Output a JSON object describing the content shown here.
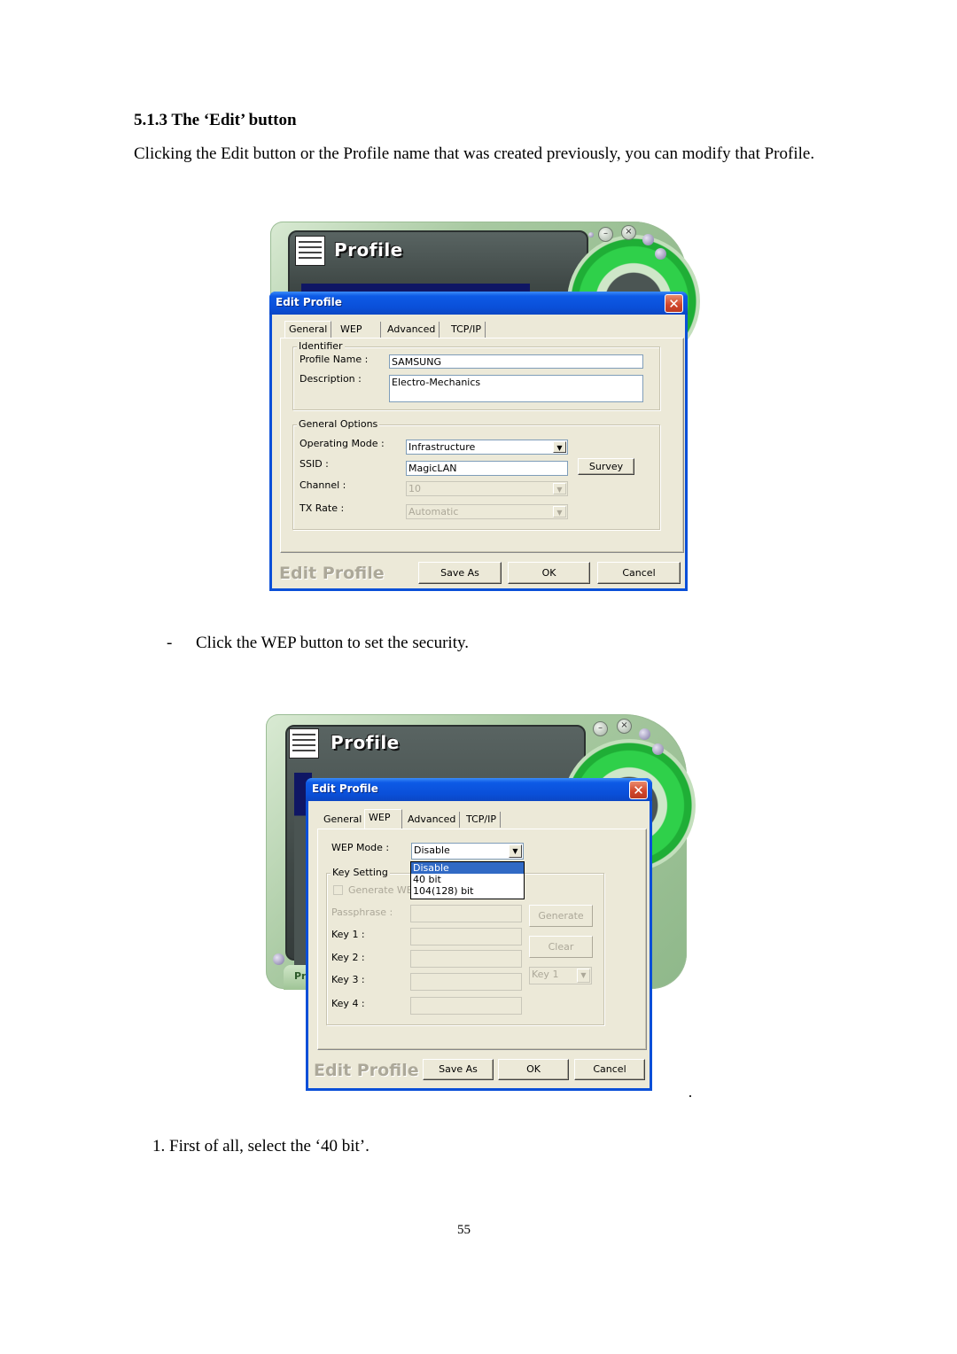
{
  "document": {
    "heading": "5.1.3 The ‘Edit’ button",
    "paragraph": "Clicking the Edit button or the Profile name that was created previously, you can modify that Profile.",
    "bullet_dash": "-",
    "bullet_text": "Click the WEP button to set the security.",
    "step_text": "1. First of all, select the ‘40 bit’.",
    "page_number": "55"
  },
  "screenshot1": {
    "app_title": "Profile",
    "app_buttons": {
      "minimize": "–",
      "close": "×"
    },
    "dialog_title": "Edit Profile",
    "close_glyph": "✕",
    "tabs": [
      "General",
      "WEP",
      "Advanced",
      "TCP/IP"
    ],
    "active_tab": "General",
    "identifier": {
      "group_label": "Identifier",
      "profile_name_label": "Profile Name :",
      "profile_name_value": "SAMSUNG",
      "description_label": "Description :",
      "description_value": "Electro-Mechanics"
    },
    "general_options": {
      "group_label": "General Options",
      "operating_mode_label": "Operating Mode :",
      "operating_mode_value": "Infrastructure",
      "ssid_label": "SSID :",
      "ssid_value": "MagicLAN",
      "survey_button": "Survey",
      "channel_label": "Channel :",
      "channel_value": "10",
      "tx_rate_label": "TX Rate :",
      "tx_rate_value": "Automatic"
    },
    "watermark": "Edit Profile",
    "buttons": {
      "save_as": "Save As",
      "ok": "OK",
      "cancel": "Cancel"
    }
  },
  "screenshot2": {
    "app_title": "Profile",
    "app_buttons": {
      "minimize": "–",
      "close": "×"
    },
    "bottom_tab_label": "Pr",
    "dialog_title": "Edit Profile",
    "close_glyph": "✕",
    "tabs": [
      "General",
      "WEP",
      "Advanced",
      "TCP/IP"
    ],
    "active_tab": "WEP",
    "wep_mode_label": "WEP Mode :",
    "wep_mode_value": "Disable",
    "wep_mode_options": [
      "Disable",
      "40 bit",
      "104(128) bit"
    ],
    "wep_mode_highlighted": "Disable",
    "key_setting": {
      "group_label": "Key Setting",
      "generate_checkbox_label": "Generate WEP",
      "generate_checked": false,
      "passphrase_label": "Passphrase :",
      "passphrase_value": "",
      "generate_button": "Generate",
      "key1_label": "Key 1 :",
      "key2_label": "Key 2 :",
      "key3_label": "Key 3 :",
      "key4_label": "Key 4 :",
      "clear_button": "Clear",
      "default_key_value": "Key 1"
    },
    "watermark": "Edit Profile",
    "buttons": {
      "save_as": "Save As",
      "ok": "OK",
      "cancel": "Cancel"
    }
  }
}
